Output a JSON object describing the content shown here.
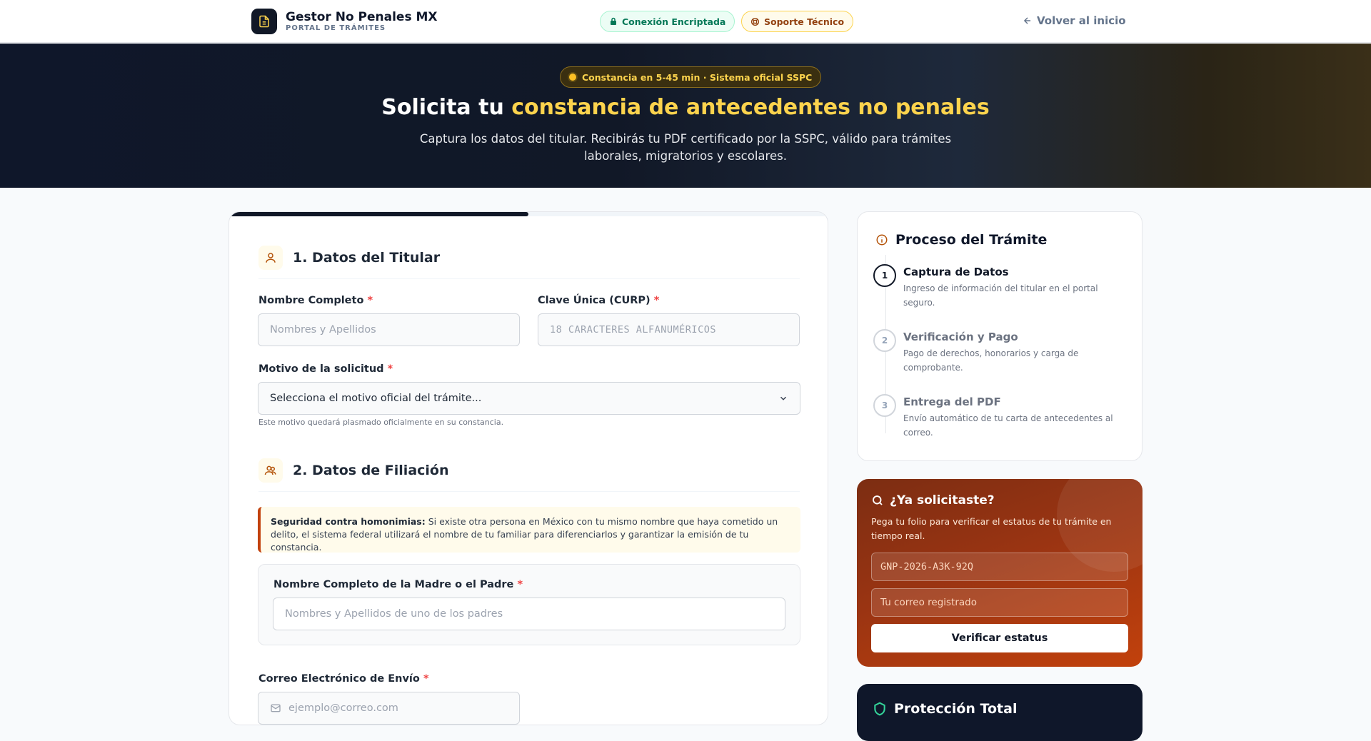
{
  "header": {
    "brand_name": "Gestor No Penales MX",
    "brand_sub": "PORTAL DE TRÁMITES",
    "secure_label": "Conexión Encriptada",
    "support_label": "Soporte Técnico",
    "back_label": "Volver al inicio"
  },
  "hero": {
    "badge": "Constancia en 5-45 min · Sistema oficial SSPC",
    "title_plain": "Solicita tu ",
    "title_accent": "constancia de antecedentes no penales",
    "subtitle": "Captura los datos del titular. Recibirás tu PDF certificado por la SSPC, válido para trámites laborales, migratorios y escolares."
  },
  "form": {
    "progress": 0.5,
    "section1": {
      "title": "1. Datos del Titular",
      "name_label": "Nombre Completo",
      "name_placeholder": "Nombres y Apellidos",
      "curp_label": "Clave Única (CURP)",
      "curp_placeholder": "18 CARACTERES ALFANUMÉRICOS",
      "reason_label": "Motivo de la solicitud",
      "reason_value": "Selecciona el motivo oficial del trámite...",
      "reason_hint": "Este motivo quedará plasmado oficialmente en su constancia."
    },
    "section2": {
      "title": "2. Datos de Filiación",
      "alert_bold": "Seguridad contra homonimias:",
      "alert_text": " Si existe otra persona en México con tu mismo nombre que haya cometido un delito, el sistema federal utilizará el nombre de tu familiar para diferenciarlos y garantizar la emisión de tu constancia.",
      "parent_label": "Nombre Completo de la Madre o el Padre",
      "parent_placeholder": "Nombres y Apellidos de uno de los padres"
    },
    "email_label": "Correo Electrónico de Envío",
    "email_placeholder": "ejemplo@correo.com",
    "required_mark": "*"
  },
  "sidebar": {
    "process_title": "Proceso del Trámite",
    "steps": [
      {
        "num": "1",
        "title": "Captura de Datos",
        "desc": "Ingreso de información del titular en el portal seguro."
      },
      {
        "num": "2",
        "title": "Verificación y Pago",
        "desc": "Pago de derechos, honorarios y carga de comprobante."
      },
      {
        "num": "3",
        "title": "Entrega del PDF",
        "desc": "Envío automático de tu carta de antecedentes al correo."
      }
    ],
    "status": {
      "title": "¿Ya solicitaste?",
      "desc": "Pega tu folio para verificar el estatus de tu trámite en tiempo real.",
      "folio_placeholder": "GNP-2026-A3K-92Q",
      "email_placeholder": "Tu correo registrado",
      "button": "Verificar estatus"
    },
    "protection_title": "Protección Total"
  },
  "colors": {
    "accent": "#fcd34d",
    "brand_dark": "#111827",
    "orange": "#c2410c",
    "success": "#047857"
  }
}
